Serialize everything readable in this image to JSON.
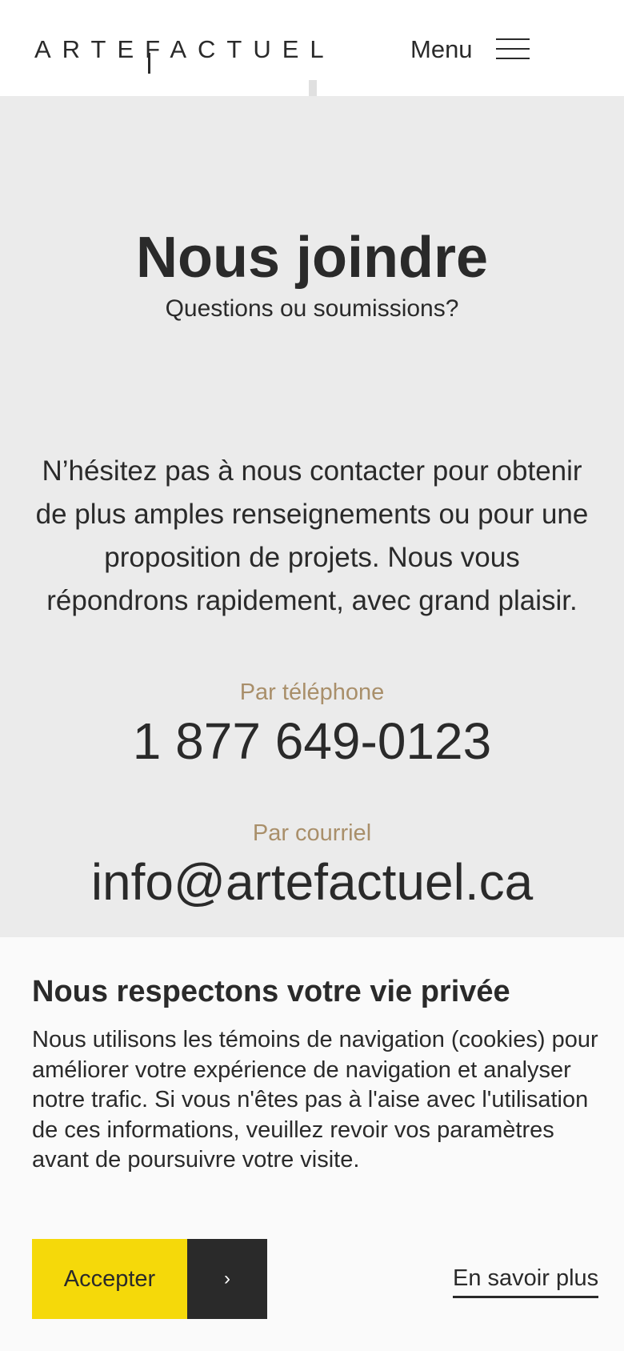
{
  "header": {
    "logo_text": "ARTEFACTUEL",
    "menu_label": "Menu",
    "menu_icon": "hamburger-icon"
  },
  "main": {
    "title": "Nous joindre",
    "subtitle": "Questions ou soumissions?",
    "intro": "N’hésitez pas à nous contacter pour obtenir de plus amples renseignements ou pour une proposition de projets. Nous vous répondrons rapidement, avec grand plaisir.",
    "phone_label": "Par téléphone",
    "phone_value": "1 877 649-0123",
    "email_label": "Par courriel",
    "email_value": "info@artefactuel.ca"
  },
  "cookie_banner": {
    "title": "Nous respectons votre vie privée",
    "text": "Nous utilisons les témoins de navigation (cookies) pour améliorer votre expérience de navigation et analyser notre trafic. Si vous n'êtes pas à l'aise avec l'utilisation de ces informations, veuillez revoir vos paramètres avant de poursuivre votre visite.",
    "accept_label": "Accepter",
    "arrow_glyph": "›",
    "learn_more_label": "En savoir plus"
  },
  "colors": {
    "accent_yellow": "#f5d90a",
    "label_gold": "#a98f6a",
    "text_dark": "#2a2a2a",
    "page_bg": "#ebebeb"
  }
}
